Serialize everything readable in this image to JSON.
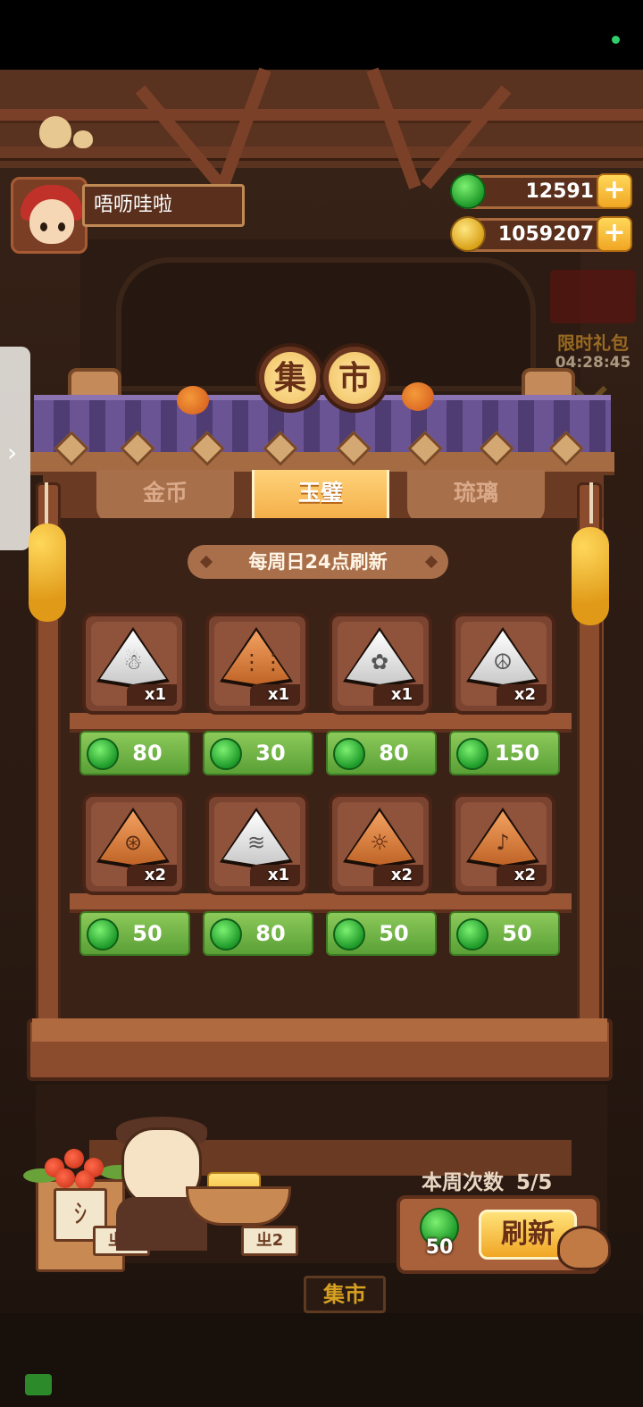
{
  "player": {
    "name": "唔呖哇啦"
  },
  "currencies": {
    "jade": {
      "icon": "jade-icon",
      "amount": "12591"
    },
    "coins": {
      "icon": "coin-icon",
      "amount": "1059207"
    }
  },
  "limited_gift": {
    "label": "限时礼包",
    "timer": "04:28:45"
  },
  "market": {
    "title_chars": [
      "集",
      "市"
    ],
    "tabs": [
      {
        "label": "金币",
        "active": false
      },
      {
        "label": "玉璧",
        "active": true
      },
      {
        "label": "琉璃",
        "active": false
      }
    ],
    "refresh_note": "每周日24点刷新",
    "items": [
      {
        "color": "white",
        "glyph": "☃",
        "qty": "x1",
        "price": "80"
      },
      {
        "color": "orange",
        "glyph": "⋮⋮",
        "qty": "x1",
        "price": "30"
      },
      {
        "color": "white",
        "glyph": "✿",
        "qty": "x1",
        "price": "80"
      },
      {
        "color": "white",
        "glyph": "☮",
        "qty": "x2",
        "price": "150"
      },
      {
        "color": "orange",
        "glyph": "⊛",
        "qty": "x2",
        "price": "50"
      },
      {
        "color": "white",
        "glyph": "≋",
        "qty": "x1",
        "price": "80"
      },
      {
        "color": "orange",
        "glyph": "☼",
        "qty": "x2",
        "price": "50"
      },
      {
        "color": "orange",
        "glyph": "♪",
        "qty": "x2",
        "price": "50"
      }
    ]
  },
  "weekly": {
    "label": "本周次数",
    "value": "5/5"
  },
  "refresh": {
    "cost": "50",
    "button_label": "刷新"
  },
  "stall_tags": [
    "ㄓ2",
    "ㄓ2"
  ],
  "bottom_sign": "集市"
}
